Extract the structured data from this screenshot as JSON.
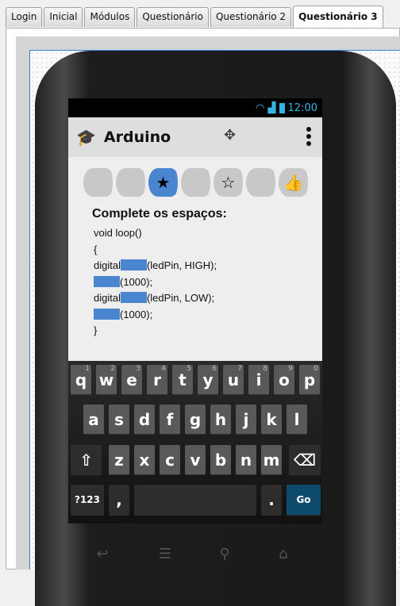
{
  "tabs": [
    "Login",
    "Inicial",
    "Módulos",
    "Questionário",
    "Questionário 2",
    "Questionário 3"
  ],
  "status": {
    "time": "12:00"
  },
  "appbar": {
    "title": "Arduino"
  },
  "steps": [
    {
      "icon": ""
    },
    {
      "icon": ""
    },
    {
      "icon": "★",
      "active": true
    },
    {
      "icon": ""
    },
    {
      "icon": "☆"
    },
    {
      "icon": ""
    },
    {
      "icon": "👍"
    }
  ],
  "quiz": {
    "heading": "Complete os espaços:",
    "lines": [
      {
        "before": "void loop()",
        "blank": false,
        "after": ""
      },
      {
        "before": "{",
        "blank": false,
        "after": ""
      },
      {
        "before": "digital",
        "blank": true,
        "after": "(ledPin, HIGH);"
      },
      {
        "before": "",
        "blank": true,
        "after": "(1000);"
      },
      {
        "before": "digital",
        "blank": true,
        "after": "(ledPin, LOW);"
      },
      {
        "before": "",
        "blank": true,
        "after": "(1000);"
      },
      {
        "before": "}",
        "blank": false,
        "after": ""
      }
    ]
  },
  "keyboard": {
    "row1": [
      [
        "q",
        "1"
      ],
      [
        "w",
        "2"
      ],
      [
        "e",
        "3"
      ],
      [
        "r",
        "4"
      ],
      [
        "t",
        "5"
      ],
      [
        "y",
        "6"
      ],
      [
        "u",
        "7"
      ],
      [
        "i",
        "8"
      ],
      [
        "o",
        "9"
      ],
      [
        "p",
        "0"
      ]
    ],
    "row2": [
      "a",
      "s",
      "d",
      "f",
      "g",
      "h",
      "j",
      "k",
      "l"
    ],
    "row3": [
      "z",
      "x",
      "c",
      "v",
      "b",
      "n",
      "m"
    ],
    "shift": "⇧",
    "backspace": "⌫",
    "symbols": "?123",
    "comma": ",",
    "period": ".",
    "go": "Go"
  },
  "colors": {
    "accent": "#4a86d0",
    "status": "#33b5e5"
  }
}
